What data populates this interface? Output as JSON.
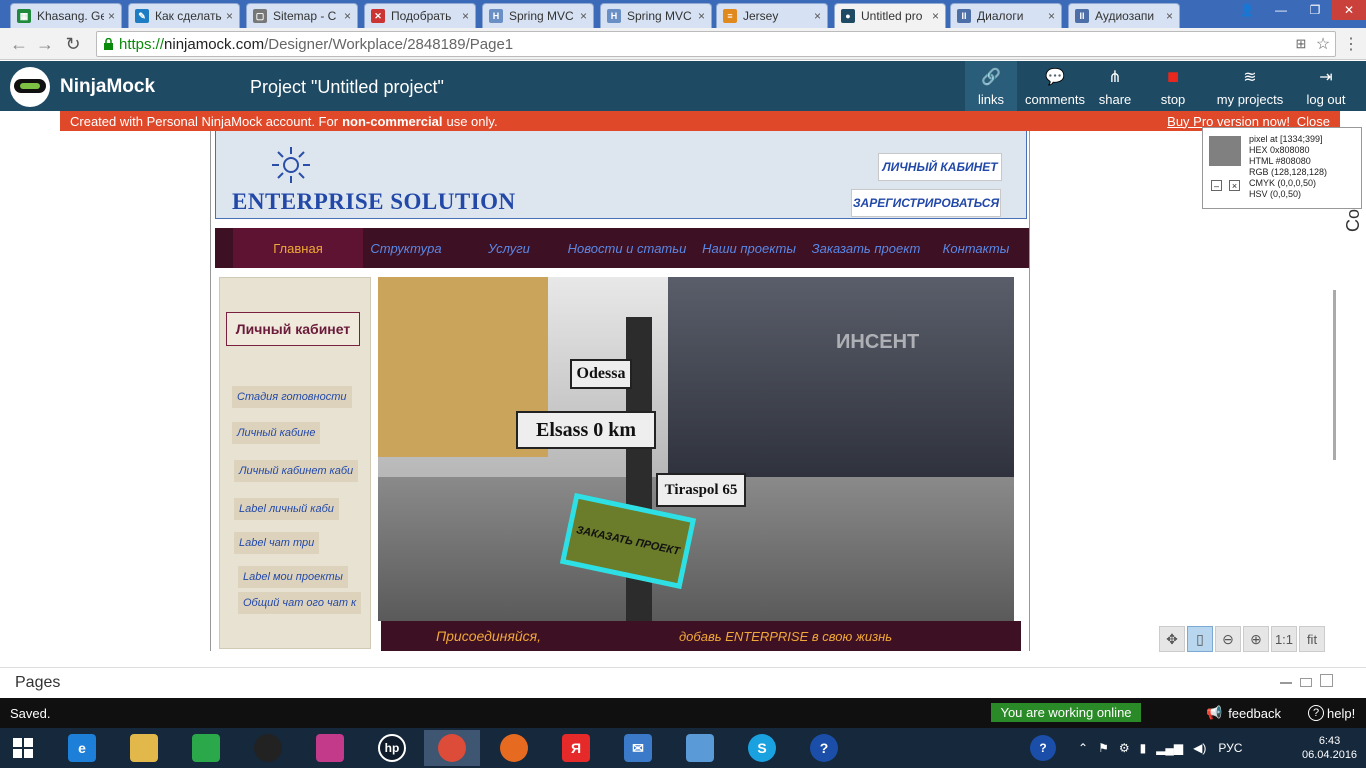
{
  "browser": {
    "tabs": [
      {
        "title": "Khasang. Ge",
        "fav_color": "#1f8a3b",
        "fav_text": "▦"
      },
      {
        "title": "Как сделать",
        "fav_color": "#1c7cc4",
        "fav_text": "✎"
      },
      {
        "title": "Sitemap - C",
        "fav_color": "#777777",
        "fav_text": "▢"
      },
      {
        "title": "Подобрать",
        "fav_color": "#c33",
        "fav_text": "✕"
      },
      {
        "title": "Spring MVC",
        "fav_color": "#6a8fc4",
        "fav_text": "H"
      },
      {
        "title": "Spring MVC",
        "fav_color": "#6a8fc4",
        "fav_text": "H"
      },
      {
        "title": "Jersey",
        "fav_color": "#e08a1e",
        "fav_text": "≡"
      },
      {
        "title": "Untitled pro",
        "fav_color": "#1e4a63",
        "fav_text": "●",
        "active": true
      },
      {
        "title": "Диалоги",
        "fav_color": "#4b6fa6",
        "fav_text": "II"
      },
      {
        "title": "Аудиозапи",
        "fav_color": "#4b6fa6",
        "fav_text": "II"
      }
    ],
    "url_scheme": "https://",
    "url_host": "ninjamock.com",
    "url_path": "/Designer/Workplace/2848189/Page1"
  },
  "app": {
    "logo": "NinjaMock",
    "project_title": "Project \"Untitled project\"",
    "tools": [
      {
        "label": "links",
        "icon": "link-icon"
      },
      {
        "label": "comments",
        "icon": "comment-icon"
      },
      {
        "label": "share",
        "icon": "share-icon"
      },
      {
        "label": "stop",
        "icon": "stop-icon"
      },
      {
        "label": "my projects",
        "icon": "layers-icon"
      },
      {
        "label": "log out",
        "icon": "logout-icon"
      }
    ],
    "banner_pre": "Created with Personal NinjaMock account. For",
    "banner_bold": "non-commercial",
    "banner_post": "use only.",
    "banner_pro": "Buy Pro version now!",
    "banner_close": "Close"
  },
  "mock": {
    "brand": "ENTERPRISE SOLUTION",
    "btn_cabinet": "ЛИЧНЫЙ КАБИНЕТ",
    "btn_register": "ЗАРЕГИСТРИРОВАТЬСЯ",
    "menu": [
      "Главная",
      "Структура",
      "Услуги",
      "Новости и статьи",
      "Наши проекты",
      "Заказать проект",
      "Контакты"
    ],
    "panel_title": "Личный кабинет",
    "panel_links": [
      "Стадия готовности",
      "Личный кабине",
      "Личный кабинет каби",
      "Label личный каби",
      "Label чат три",
      "Label мои проекты",
      "Общий чат ого чат к"
    ],
    "signs": [
      "Odessa",
      "Elsass 0 km",
      "Tiraspol 65"
    ],
    "order_btn": "ЗАКАЗАТЬ ПРОЕКТ",
    "watermark": "ИНСЕНТ",
    "footer_left": "Присоединяйся,",
    "footer_right": "добавь ENTERPRISE в свою жизнь"
  },
  "picker": {
    "pixel": "pixel at [1334;399]",
    "hex": "HEX 0x808080",
    "html": "HTML #808080",
    "rgb": "RGB (128,128,128)",
    "cmyk": "CMYK (0,0,0,50)",
    "hsv": "HSV (0,0,50)",
    "swatch_color": "#808080",
    "side_text": "Co"
  },
  "zoom": [
    "move-icon",
    "device-icon",
    "zoom-out-icon",
    "zoom-in-icon"
  ],
  "zoom_text": {
    "one": "1:1",
    "fit": "fit"
  },
  "pages": {
    "label": "Pages"
  },
  "status": {
    "saved": "Saved.",
    "online": "You are working online",
    "feedback": "feedback",
    "help": "help!"
  },
  "taskbar": {
    "lang": "РУС",
    "time": "6:43",
    "date": "06.04.2016"
  }
}
